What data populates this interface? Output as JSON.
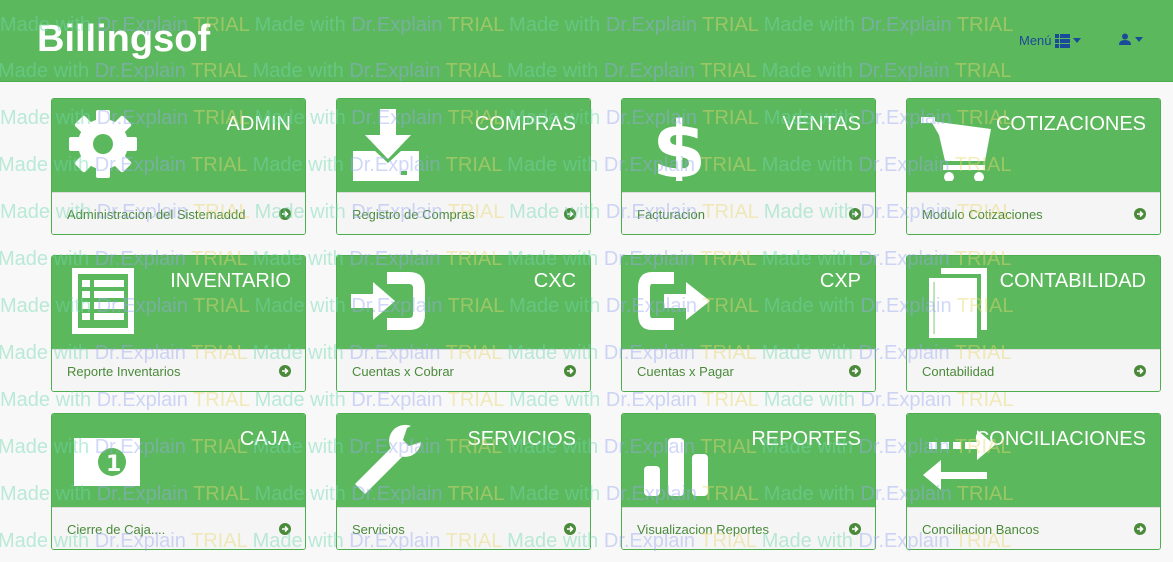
{
  "app": {
    "brand": "Billingsof",
    "menu_label": "Menú",
    "accent_color": "#5cb85c",
    "link_color": "#1a4a9a"
  },
  "nav": {
    "menu_icon": "th-large-icon",
    "user_icon": "user-icon"
  },
  "watermark": {
    "segment_a": "Made with ",
    "segment_b": "Dr.Explain ",
    "segment_c": "TRIAL "
  },
  "panels": [
    {
      "title": "ADMIN",
      "icon": "gear-icon",
      "footer": "Administracion del Sistemaddd"
    },
    {
      "title": "COMPRAS",
      "icon": "download-icon",
      "footer": "Registro de Compras"
    },
    {
      "title": "VENTAS",
      "icon": "dollar-icon",
      "footer": "Facturacion"
    },
    {
      "title": "COTIZACIONES",
      "icon": "shopping-cart-icon",
      "footer": "Modulo Cotizaciones"
    },
    {
      "title": "INVENTARIO",
      "icon": "list-alt-icon",
      "footer": "Reporte Inventarios"
    },
    {
      "title": "CXC",
      "icon": "sign-in-icon",
      "footer": "Cuentas x Cobrar"
    },
    {
      "title": "CXP",
      "icon": "sign-out-icon",
      "footer": "Cuentas x Pagar"
    },
    {
      "title": "CONTABILIDAD",
      "icon": "book-icon",
      "footer": "Contabilidad"
    },
    {
      "title": "CAJA",
      "icon": "money-icon",
      "footer": "Cierre de Caja...."
    },
    {
      "title": "SERVICIOS",
      "icon": "wrench-icon",
      "footer": "Servicios"
    },
    {
      "title": "REPORTES",
      "icon": "bar-chart-icon",
      "footer": "Visualizacion Reportes"
    },
    {
      "title": "CONCILIACIONES",
      "icon": "exchange-icon",
      "footer": "Conciliacion Bancos"
    }
  ]
}
